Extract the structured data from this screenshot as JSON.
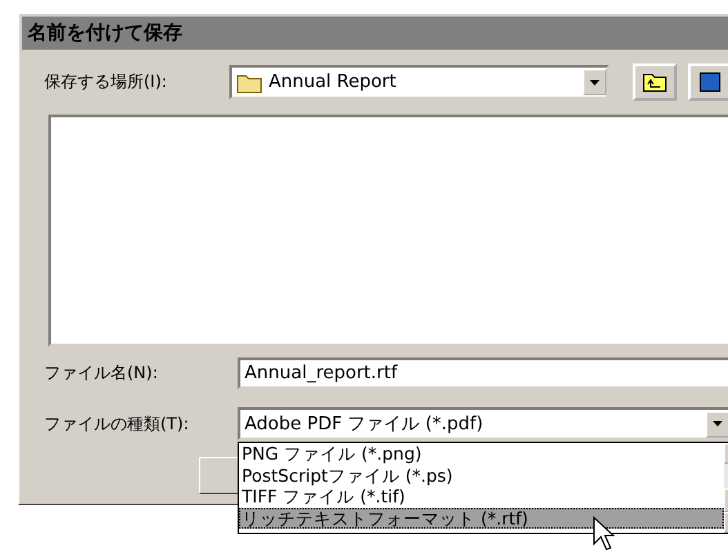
{
  "window": {
    "title": "名前を付けて保存"
  },
  "save_in": {
    "label": "保存する場所(I):",
    "value": "Annual Report"
  },
  "file_name": {
    "label": "ファイル名(N):",
    "value": "Annual_report.rtf"
  },
  "file_type": {
    "label": "ファイルの種類(T):",
    "value": "Adobe PDF ファイル (*.pdf)",
    "expanded": true,
    "options": [
      {
        "label": "PNG ファイル (*.png)",
        "selected": false
      },
      {
        "label": "PostScriptファイル (*.ps)",
        "selected": false
      },
      {
        "label": "TIFF ファイル (*.tif)",
        "selected": false
      },
      {
        "label": "リッチテキストフォーマット (*.rtf)",
        "selected": true
      }
    ]
  }
}
